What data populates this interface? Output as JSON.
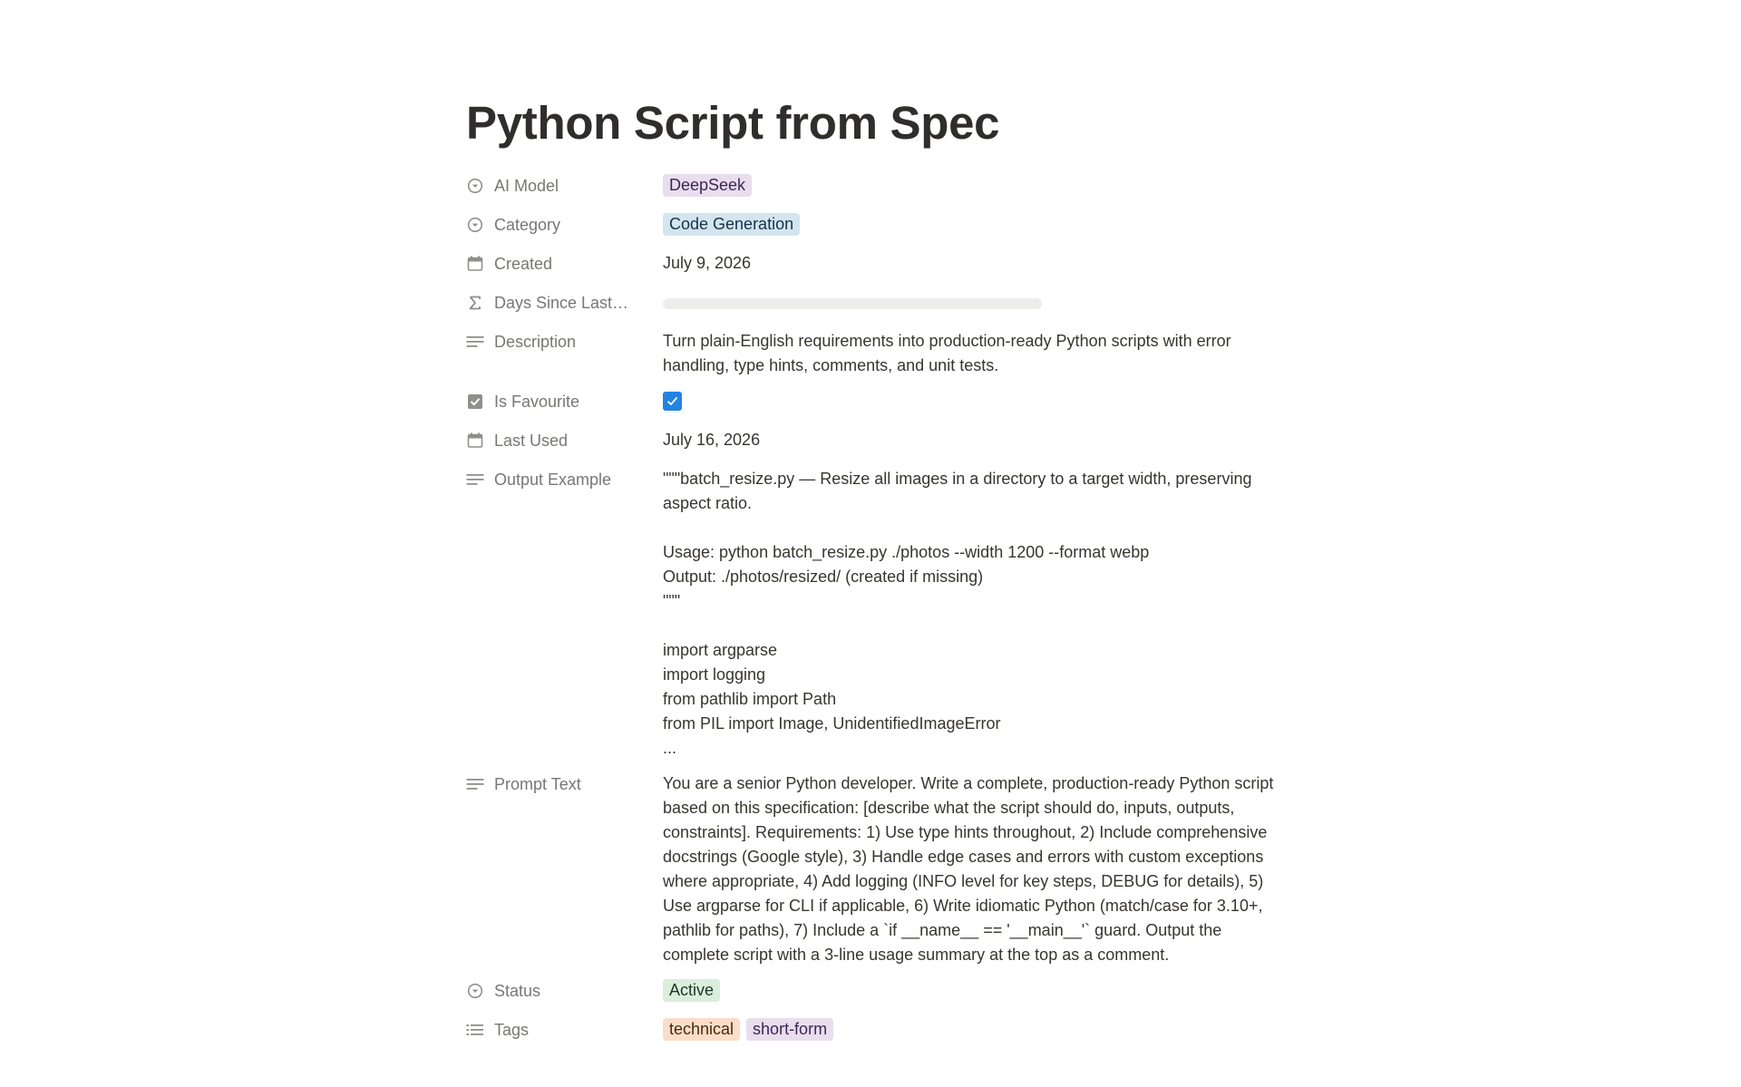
{
  "page": {
    "title": "Python Script from Spec"
  },
  "properties": {
    "ai_model": {
      "label": "AI Model",
      "icon": "select-icon",
      "value": "DeepSeek",
      "color": "#e8deee"
    },
    "category": {
      "label": "Category",
      "icon": "select-icon",
      "value": "Code Generation",
      "color": "#d3e5ef"
    },
    "created": {
      "label": "Created",
      "icon": "calendar-icon",
      "value": "July 9, 2026"
    },
    "days_since_last": {
      "label": "Days Since Last…",
      "icon": "sigma-icon",
      "value": ""
    },
    "description": {
      "label": "Description",
      "icon": "text-icon",
      "value": "Turn plain-English requirements into production-ready Python scripts with error handling, type hints, comments, and unit tests."
    },
    "is_favourite": {
      "label": "Is Favourite",
      "icon": "checkbox-icon",
      "checked": true,
      "color": "#2383e2"
    },
    "last_used": {
      "label": "Last Used",
      "icon": "calendar-icon",
      "value": "July 16, 2026"
    },
    "output_example": {
      "label": "Output Example",
      "icon": "text-icon",
      "value": "\"\"\"batch_resize.py — Resize all images in a directory to a target width, preserving aspect ratio.\n\nUsage: python batch_resize.py ./photos --width 1200 --format webp\nOutput: ./photos/resized/ (created if missing)\n\"\"\"\n\nimport argparse\nimport logging\nfrom pathlib import Path\nfrom PIL import Image, UnidentifiedImageError\n..."
    },
    "prompt_text": {
      "label": "Prompt Text",
      "icon": "text-icon",
      "value": "You are a senior Python developer. Write a complete, production-ready Python script based on this specification: [describe what the script should do, inputs, outputs, constraints]. Requirements: 1) Use type hints throughout, 2) Include comprehensive docstrings (Google style), 3) Handle edge cases and errors with custom exceptions where appropriate, 4) Add logging (INFO level for key steps, DEBUG for details), 5) Use argparse for CLI if applicable, 6) Write idiomatic Python (match/case for 3.10+, pathlib for paths), 7) Include a `if __name__ == '__main__'` guard. Output the complete script with a 3-line usage summary at the top as a comment."
    },
    "status": {
      "label": "Status",
      "icon": "status-icon",
      "value": "Active",
      "color": "#dbeddb"
    },
    "tags": {
      "label": "Tags",
      "icon": "list-icon",
      "values": [
        "technical",
        "short-form"
      ],
      "colors": [
        "#fadec9",
        "#e8deee"
      ]
    }
  }
}
